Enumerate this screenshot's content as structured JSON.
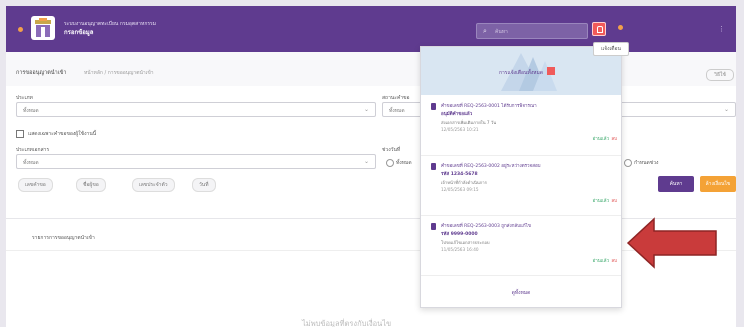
{
  "header": {
    "org_name": "ระบบงานอนุญาตทะเบียน กรมอุตสาหกรรม",
    "app_name": "กรอกข้อมูล",
    "search_placeholder": "ค้นหา",
    "tooltip": "แจ้งเตือน"
  },
  "page": {
    "title": "การขออนุญาตนำเข้า",
    "breadcrumb": "หน้าหลัก / การขออนุญาตนำเข้า",
    "help_label": "วิธีใช้"
  },
  "filters": {
    "type_label": "ประเภท",
    "type_value": "ทั้งหมด",
    "status_label": "สถานะคำขอ",
    "status_value": "ทั้งหมด",
    "checkbox_label": "แสดงเฉพาะคำขอของผู้ใช้งานนี้",
    "doc_label": "ประเภทเอกสาร",
    "doc_value": "ทั้งหมด",
    "period_label": "ช่วงวันที่",
    "period_opt1": "ทั้งหมด",
    "period_opt2": "กำหนดช่วง",
    "tags": [
      "เลขคำขอ",
      "ชื่อผู้ขอ",
      "เลขประจำตัว",
      "วันที่"
    ],
    "search_button": "ค้นหา",
    "reset_button": "ล้างเงื่อนไข"
  },
  "list": {
    "title": "รายการการขออนุญาตนำเข้า",
    "empty": "ไม่พบข้อมูลที่ตรงกับเงื่อนไข"
  },
  "notifications": {
    "title": "การแจ้งเตือนทั้งหมด",
    "items": [
      {
        "line1": "คำขอเลขที่ REQ-2563-0001 ได้รับการพิจารณา",
        "line2": "อนุมัติคำขอแล้ว",
        "line3": "ส่งเอกสารเพิ่มเติมภายใน 7 วัน",
        "date": "12/05/2563 10:21",
        "status": "อ่านแล้ว",
        "delete": "ลบ"
      },
      {
        "line1": "คำขอเลขที่ REQ-2563-0002 อยู่ระหว่างตรวจสอบ",
        "line2": "รหัส 1234-5678",
        "line3": "เจ้าหน้าที่กำลังดำเนินการ",
        "date": "12/05/2563 09:15",
        "status": "อ่านแล้ว",
        "delete": "ลบ"
      },
      {
        "line1": "คำขอเลขที่ REQ-2563-0003 ถูกส่งกลับแก้ไข",
        "line2": "รหัส 9999-0000",
        "line3": "โปรดแก้ไขเอกสารประกอบ",
        "date": "11/05/2563 16:40",
        "status": "อ่านแล้ว",
        "delete": "ลบ"
      }
    ],
    "footer": "ดูทั้งหมด"
  },
  "colors": {
    "brand": "#5f3b8f",
    "accent": "#f4a236",
    "alert": "#f05a5a",
    "arrow": "#c93b3b"
  }
}
